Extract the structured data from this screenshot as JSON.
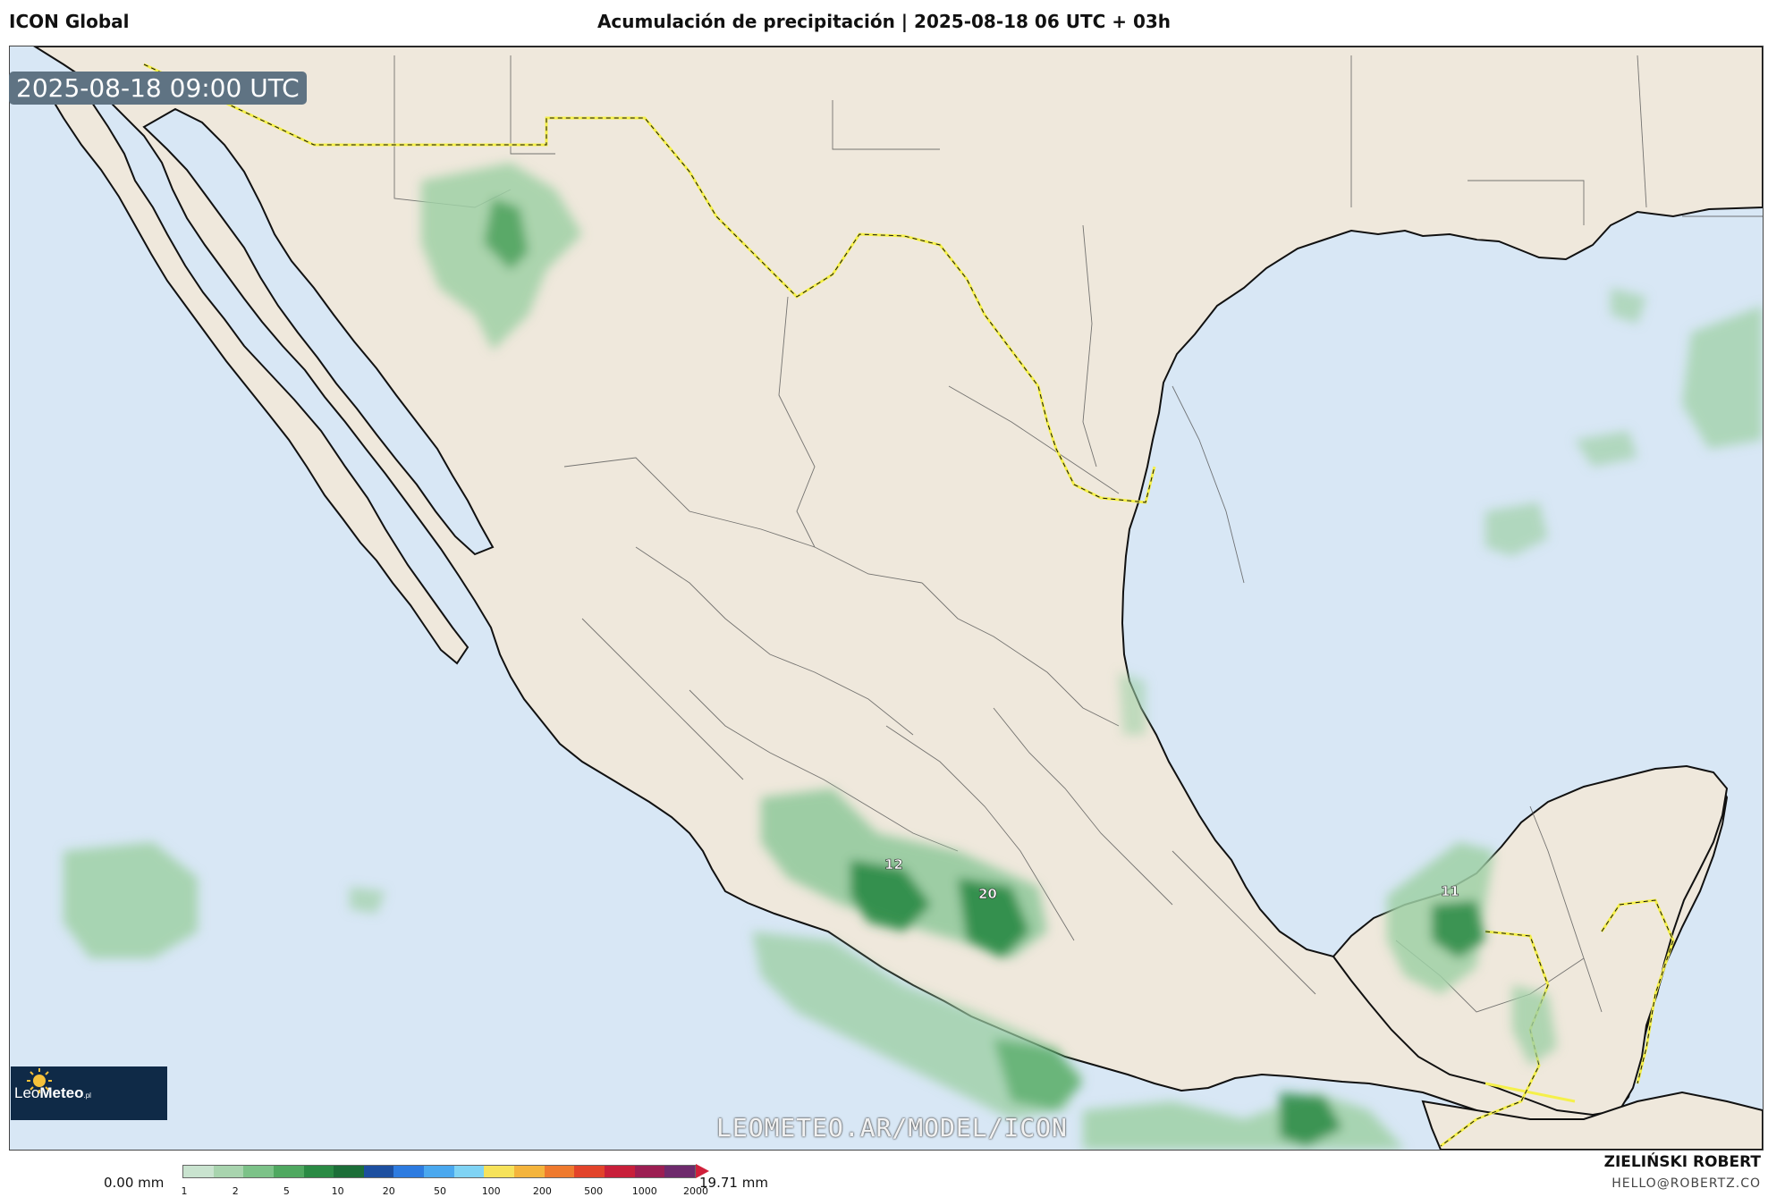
{
  "header": {
    "model": "ICON Global",
    "title": "Acumulación de precipitación | 2025-08-18 06 UTC + 03h"
  },
  "map": {
    "timestamp": "2025-08-18 09:00 UTC",
    "watermark": "LEOMETEO.AR/MODEL/ICON",
    "logo": {
      "brand_light": "Leo",
      "brand_bold": "Meteo",
      "suffix": ".pl"
    },
    "colors": {
      "ocean": "#d8e7f5",
      "land": "#efe8dc",
      "border_highlight": "#f5f04a",
      "rain_light": "#9fd0a6",
      "rain_heavy": "#1f7a3a"
    },
    "rain_labels": [
      {
        "name": "max-jalisco",
        "text": "12"
      },
      {
        "name": "max-michoacan",
        "text": "20"
      },
      {
        "name": "max-campeche",
        "text": "11"
      }
    ]
  },
  "legend": {
    "min_label": "0.00 mm",
    "max_label": "19.71 mm",
    "ticks": [
      "1",
      "2",
      "5",
      "10",
      "20",
      "50",
      "100",
      "200",
      "500",
      "1000",
      "2000"
    ],
    "colors": [
      "#c9e3cf",
      "#a8d4ae",
      "#7cc288",
      "#4fa860",
      "#2a8a44",
      "#1c6e38",
      "#1d4fa0",
      "#2d7be0",
      "#4aa8ef",
      "#7fd3f4",
      "#f6e25a",
      "#f4b43c",
      "#ef7a2e",
      "#e2432a",
      "#c81f3a",
      "#9c1e52",
      "#6e2a6c"
    ]
  },
  "credit": {
    "author": "ZIELIŃSKI ROBERT",
    "email": "HELLO@ROBERTZ.CO"
  }
}
